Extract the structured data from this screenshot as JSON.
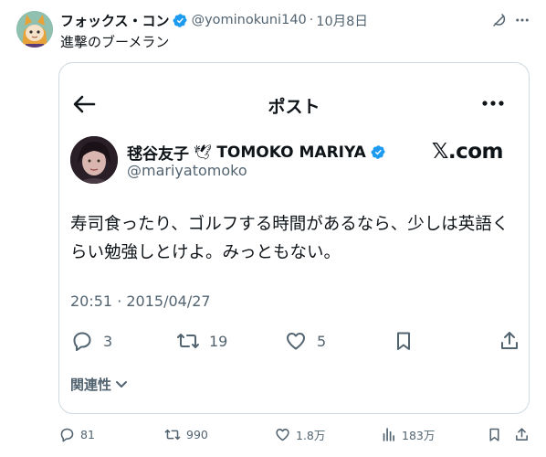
{
  "post": {
    "display_name": "フォックス・コン",
    "handle": "@yominokuni140",
    "separator": "·",
    "date": "10月8日",
    "text": "進撃のブーメラン",
    "stats": {
      "replies": "81",
      "reposts": "990",
      "likes": "1.8万",
      "views": "183万"
    }
  },
  "embed": {
    "title": "ポスト",
    "author_name": "毬谷友子",
    "author_dove": "🕊",
    "author_name_en": "TOMOKO MARIYA",
    "author_handle": "@mariyatomoko",
    "brand": "𝕏.com",
    "text": "寿司食ったり、ゴルフする時間があるなら、少しは英語くらい勉強しとけよ。みっともない。",
    "timestamp": "20:51 · 2015/04/27",
    "replies": "3",
    "reposts": "19",
    "likes": "5",
    "related_label": "関連性"
  },
  "colors": {
    "verified": "#1d9bf0",
    "text": "#0f1419",
    "muted": "#536471",
    "border": "#cfd9de"
  },
  "icons": [
    "grok-icon",
    "more-icon",
    "back-arrow-icon",
    "verified-icon",
    "reply-icon",
    "repost-icon",
    "like-icon",
    "bookmark-icon",
    "share-icon",
    "views-icon",
    "chevron-down-icon"
  ]
}
